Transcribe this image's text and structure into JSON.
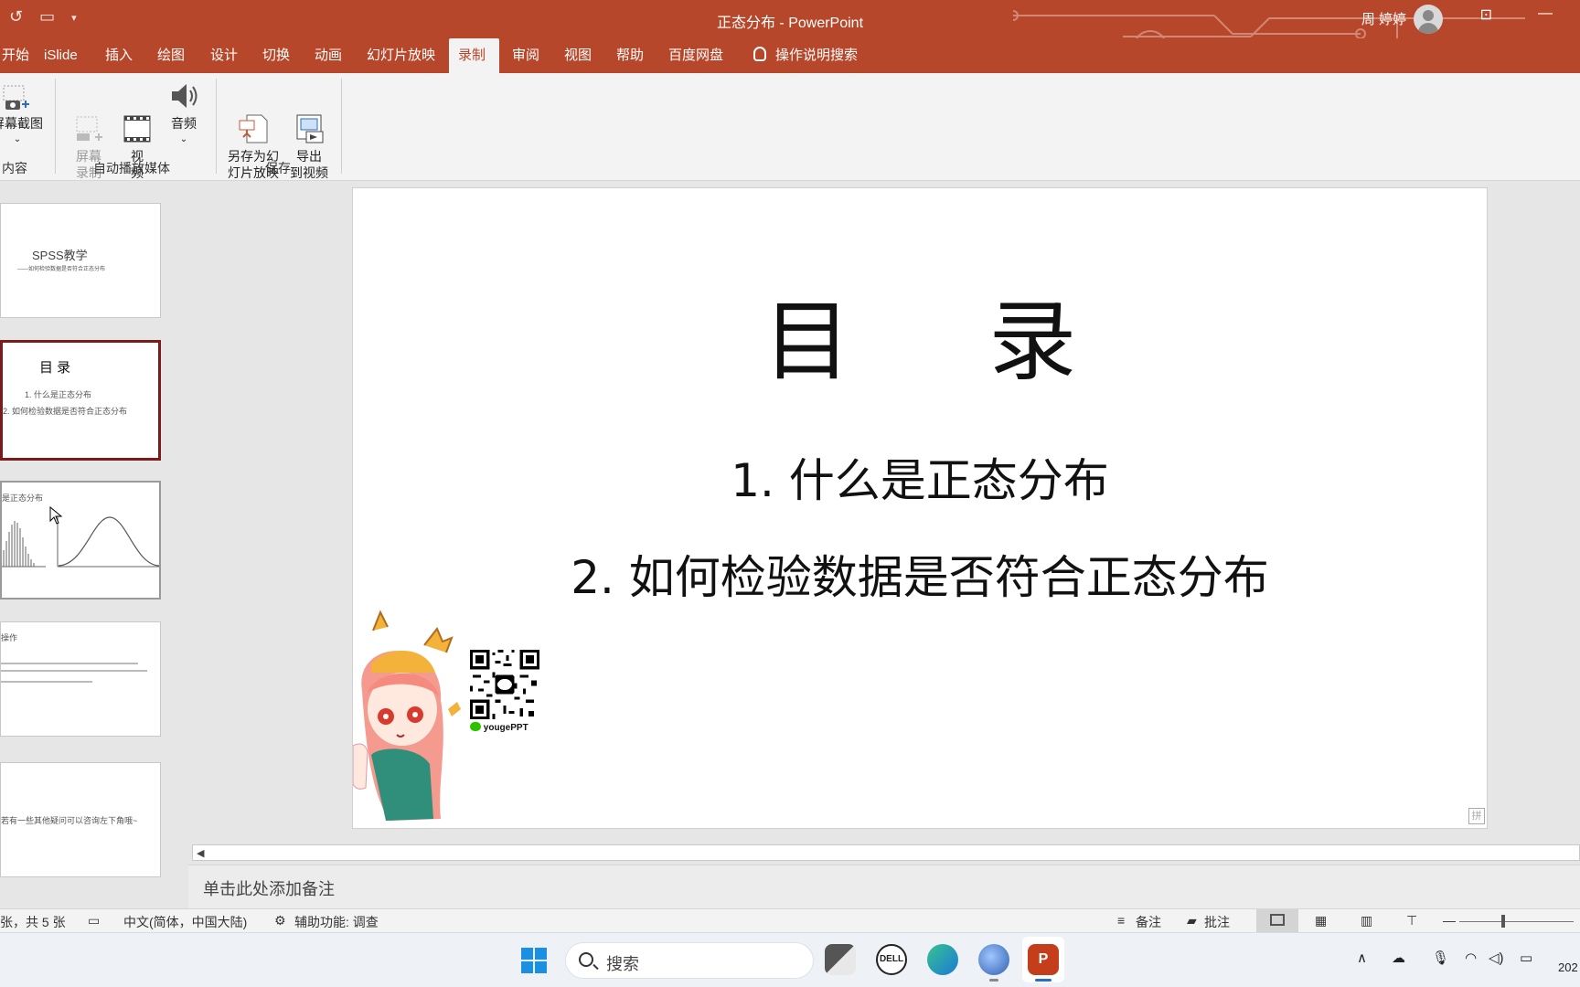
{
  "app": {
    "doc_title": "正态分布 - PowerPoint",
    "user_name": "周 婷婷"
  },
  "tabs": [
    {
      "label": "开始"
    },
    {
      "label": "iSlide"
    },
    {
      "label": "插入"
    },
    {
      "label": "绘图"
    },
    {
      "label": "设计"
    },
    {
      "label": "切换"
    },
    {
      "label": "动画"
    },
    {
      "label": "幻灯片放映"
    },
    {
      "label": "录制",
      "active": true
    },
    {
      "label": "审阅"
    },
    {
      "label": "视图"
    },
    {
      "label": "帮助"
    },
    {
      "label": "百度网盘"
    },
    {
      "label": "操作说明搜索"
    }
  ],
  "ribbon": {
    "screenshot_label": "屏幕截图",
    "screen_record_label": "屏幕\n录制",
    "video_label": "视\n频",
    "audio_label": "音频",
    "save_as_show_label": "另存为幻\n灯片放映",
    "export_video_label": "导出\n到视频",
    "group_content": "内容",
    "group_media": "自动播放媒体",
    "group_save": "保存"
  },
  "thumbnails": {
    "s1_title": "SPSS教学",
    "s1_sub": "——如何检验数据是否符合正态分布",
    "s2_title": "目 录",
    "s2_item1": "1. 什么是正态分布",
    "s2_item2": "2. 如何检验数据是否符合正态分布",
    "s3_title": "是正态分布",
    "s4_title": "操作",
    "s5_text": "若有一些其他疑问可以咨询左下角哦~"
  },
  "slide": {
    "title": "目 录",
    "item1": "1. 什么是正态分布",
    "item2": "2. 如何检验数据是否符合正态分布",
    "qr_caption": "yougePPT"
  },
  "notes": {
    "placeholder": "单击此处添加备注"
  },
  "status": {
    "slide_info": "张，共 5 张",
    "language": "中文(简体，中国大陆)",
    "accessibility": "辅助功能: 调查",
    "notes_btn": "备注",
    "comments_btn": "批注"
  },
  "taskbar": {
    "search_placeholder": "搜索",
    "clock_partial": "202"
  },
  "colors": {
    "accent": "#b7472a",
    "selected_border": "#7b1b1b"
  }
}
